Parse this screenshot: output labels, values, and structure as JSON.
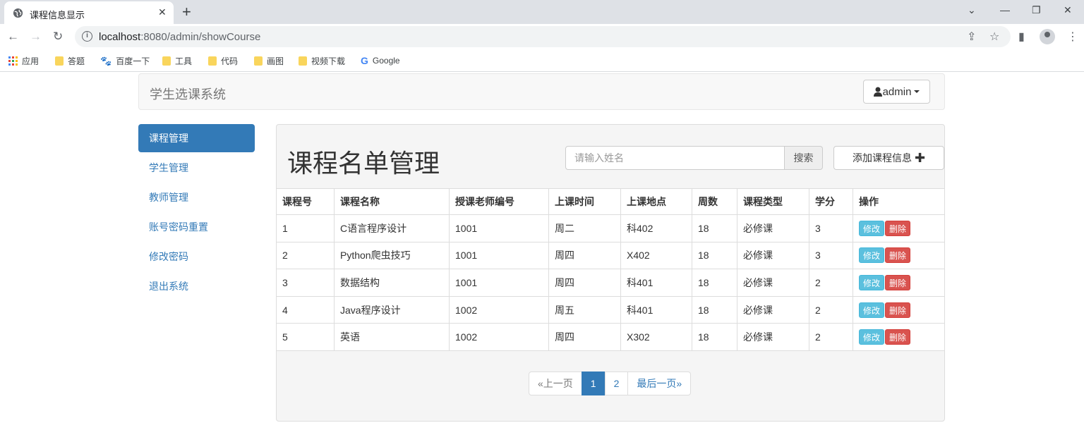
{
  "browser": {
    "tab_title": "课程信息显示",
    "url_host": "localhost",
    "url_path": ":8080/admin/showCourse",
    "bookmarks": [
      "应用",
      "答题",
      "百度一下",
      "工具",
      "代码",
      "画图",
      "视频下载",
      "Google"
    ]
  },
  "header": {
    "brand": "学生选课系统",
    "user": "admin"
  },
  "sidebar": {
    "items": [
      {
        "label": "课程管理",
        "active": true
      },
      {
        "label": "学生管理"
      },
      {
        "label": "教师管理"
      },
      {
        "label": "账号密码重置"
      },
      {
        "label": "修改密码"
      },
      {
        "label": "退出系统"
      }
    ]
  },
  "main": {
    "title": "课程名单管理",
    "search_placeholder": "请输入姓名",
    "search_button": "搜索",
    "add_button": "添加课程信息"
  },
  "table": {
    "headers": [
      "课程号",
      "课程名称",
      "授课老师编号",
      "上课时间",
      "上课地点",
      "周数",
      "课程类型",
      "学分",
      "操作"
    ],
    "rows": [
      [
        "1",
        "C语言程序设计",
        "1001",
        "周二",
        "科402",
        "18",
        "必修课",
        "3"
      ],
      [
        "2",
        "Python爬虫技巧",
        "1001",
        "周四",
        "X402",
        "18",
        "必修课",
        "3"
      ],
      [
        "3",
        "数据结构",
        "1001",
        "周四",
        "科401",
        "18",
        "必修课",
        "2"
      ],
      [
        "4",
        "Java程序设计",
        "1002",
        "周五",
        "科401",
        "18",
        "必修课",
        "2"
      ],
      [
        "5",
        "英语",
        "1002",
        "周四",
        "X302",
        "18",
        "必修课",
        "2"
      ]
    ],
    "edit_label": "修改",
    "delete_label": "删除"
  },
  "pagination": {
    "prev": "«上一页",
    "pages": [
      "1",
      "2"
    ],
    "current": "1",
    "last": "最后一页»"
  },
  "colors": {
    "primary": "#337ab7",
    "info": "#5bc0de",
    "danger": "#d9534f"
  }
}
